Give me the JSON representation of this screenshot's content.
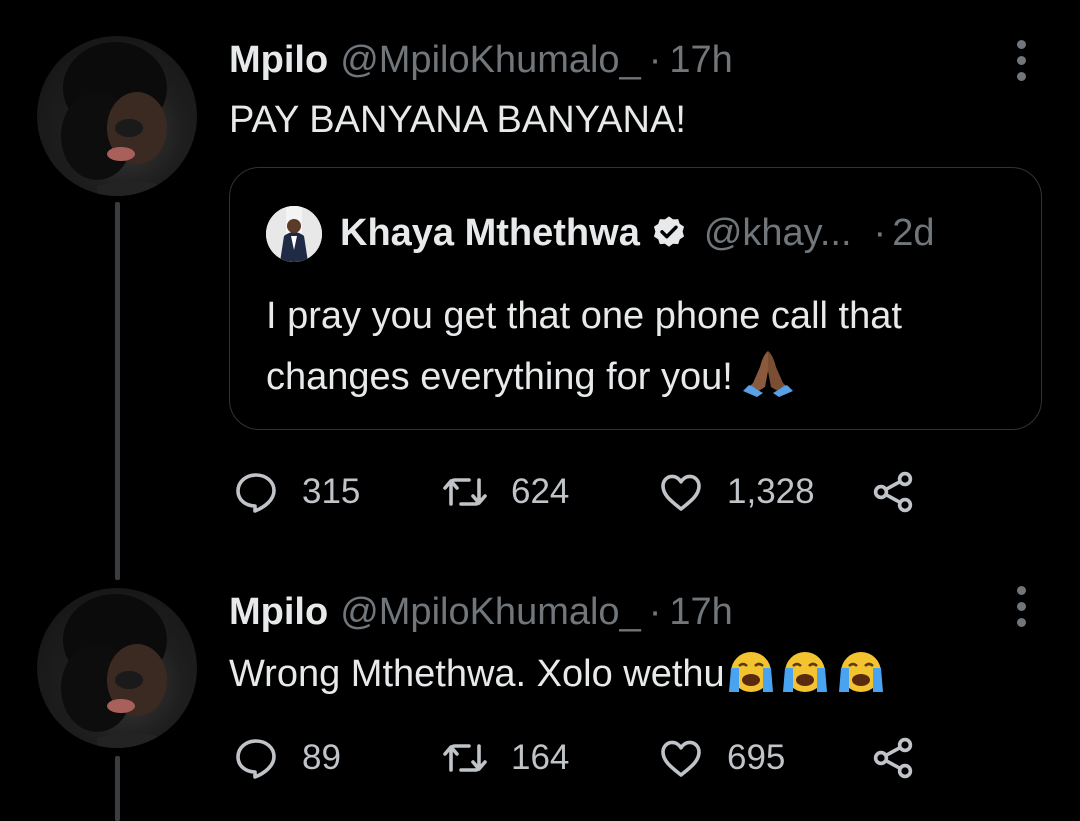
{
  "tweets": [
    {
      "author_name": "Mpilo",
      "handle": "@MpiloKhumalo_",
      "separator": "·",
      "time": "17h",
      "text": "PAY BANYANA BANYANA!",
      "quote": {
        "author_name": "Khaya Mthethwa",
        "verified": true,
        "handle": "@khay...",
        "separator": "·",
        "time": "2d",
        "text": "I pray you get that one phone call that changes everything for you!",
        "emoji": "folded-hands"
      },
      "actions": {
        "replies": "315",
        "retweets": "624",
        "likes": "1,328"
      }
    },
    {
      "author_name": "Mpilo",
      "handle": "@MpiloKhumalo_",
      "separator": "·",
      "time": "17h",
      "text": "Wrong Mthethwa. Xolo wethu",
      "emoji": [
        "loudly-crying-face",
        "loudly-crying-face",
        "loudly-crying-face"
      ],
      "actions": {
        "replies": "89",
        "retweets": "164",
        "likes": "695"
      }
    }
  ],
  "colors": {
    "background": "#000000",
    "text_primary": "#e7e9ea",
    "text_secondary": "#71767b",
    "border": "#2f3336"
  }
}
